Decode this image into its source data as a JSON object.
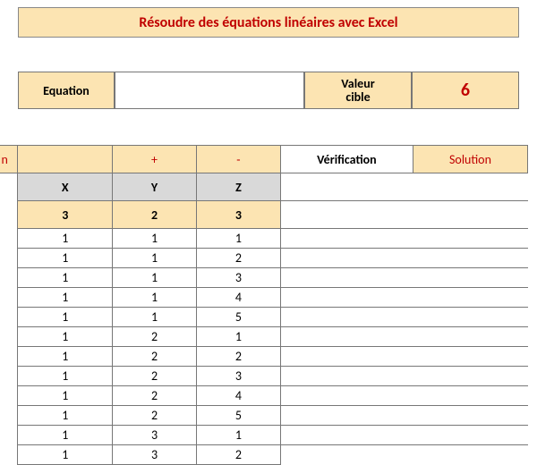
{
  "title": "Résoudre des équations linéaires avec Excel",
  "header": {
    "equation_label": "Equation",
    "equation_value": "",
    "target_label_line1": "Valeur",
    "target_label_line2": "cible",
    "target_value": "6"
  },
  "table": {
    "left_frag": "n",
    "col_headers": {
      "b": "",
      "c": "+",
      "d": "-",
      "e": "Vérification",
      "f": "Solution"
    },
    "var_headers": {
      "x": "X",
      "y": "Y",
      "z": "Z"
    },
    "coeff": {
      "x": "3",
      "y": "2",
      "z": "3"
    },
    "rows": [
      {
        "x": "1",
        "y": "1",
        "z": "1"
      },
      {
        "x": "1",
        "y": "1",
        "z": "2"
      },
      {
        "x": "1",
        "y": "1",
        "z": "3"
      },
      {
        "x": "1",
        "y": "1",
        "z": "4"
      },
      {
        "x": "1",
        "y": "1",
        "z": "5"
      },
      {
        "x": "1",
        "y": "2",
        "z": "1"
      },
      {
        "x": "1",
        "y": "2",
        "z": "2"
      },
      {
        "x": "1",
        "y": "2",
        "z": "3"
      },
      {
        "x": "1",
        "y": "2",
        "z": "4"
      },
      {
        "x": "1",
        "y": "2",
        "z": "5"
      },
      {
        "x": "1",
        "y": "3",
        "z": "1"
      },
      {
        "x": "1",
        "y": "3",
        "z": "2"
      }
    ]
  }
}
